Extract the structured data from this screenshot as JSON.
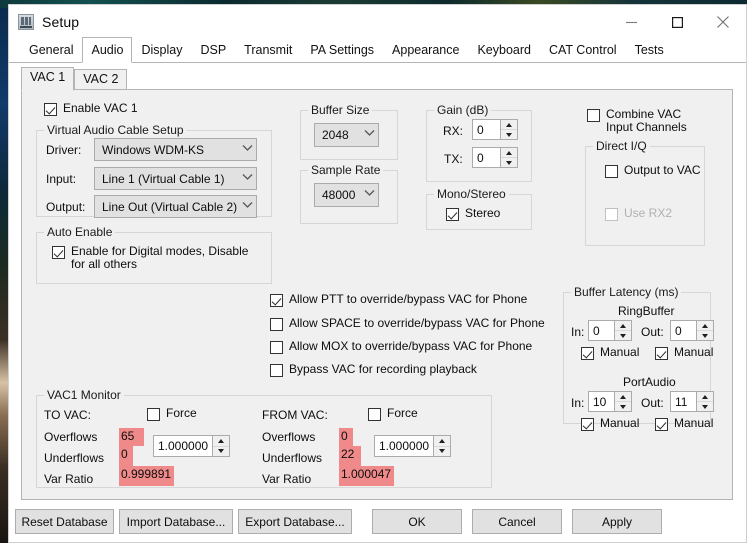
{
  "window": {
    "title": "Setup",
    "icon": "app-window-icon",
    "controls": {
      "minimize": "minimize-icon",
      "maximize": "maximize-icon",
      "close": "close-icon"
    }
  },
  "tabs": {
    "selected": "Audio",
    "items": [
      {
        "label": "General"
      },
      {
        "label": "Audio"
      },
      {
        "label": "Display"
      },
      {
        "label": "DSP"
      },
      {
        "label": "Transmit"
      },
      {
        "label": "PA Settings"
      },
      {
        "label": "Appearance"
      },
      {
        "label": "Keyboard"
      },
      {
        "label": "CAT Control"
      },
      {
        "label": "Tests"
      }
    ]
  },
  "subtabs": {
    "selected": "VAC 1",
    "items": [
      {
        "label": "VAC 1"
      },
      {
        "label": "VAC 2"
      }
    ]
  },
  "enable_vac": {
    "label": "Enable VAC 1",
    "checked": true
  },
  "vac_setup": {
    "title": "Virtual Audio Cable Setup",
    "driver": {
      "label": "Driver:",
      "value": "Windows WDM-KS"
    },
    "input": {
      "label": "Input:",
      "value": "Line 1 (Virtual Cable 1)"
    },
    "output": {
      "label": "Output:",
      "value": "Line Out (Virtual Cable 2)"
    }
  },
  "auto_enable": {
    "title": "Auto Enable",
    "checkbox": {
      "label": "Enable for Digital modes, Disable\nfor all others",
      "checked": true
    }
  },
  "buffer_size": {
    "title": "Buffer Size",
    "value": "2048"
  },
  "sample_rate": {
    "title": "Sample Rate",
    "value": "48000"
  },
  "gain": {
    "title": "Gain (dB)",
    "rx": {
      "label": "RX:",
      "value": "0"
    },
    "tx": {
      "label": "TX:",
      "value": "0"
    }
  },
  "mono_stereo": {
    "title": "Mono/Stereo",
    "stereo": {
      "label": "Stereo",
      "checked": true
    }
  },
  "combine_vac": {
    "label": "Combine VAC\nInput Channels",
    "checked": false
  },
  "direct_iq": {
    "title": "Direct I/Q",
    "output_to_vac": {
      "label": "Output to VAC",
      "checked": false,
      "disabled": false
    },
    "use_rx2": {
      "label": "Use RX2",
      "checked": false,
      "disabled": true
    }
  },
  "overrides": [
    {
      "label": "Allow PTT to override/bypass VAC for Phone",
      "checked": true
    },
    {
      "label": "Allow SPACE to override/bypass VAC for Phone",
      "checked": false
    },
    {
      "label": "Allow MOX to override/bypass VAC for Phone",
      "checked": false
    },
    {
      "label": "Bypass VAC for recording playback",
      "checked": false
    }
  ],
  "buffer_latency": {
    "title": "Buffer Latency (ms)",
    "ringbuffer": {
      "heading": "RingBuffer",
      "in": {
        "label": "In:",
        "value": "0"
      },
      "out": {
        "label": "Out:",
        "value": "0"
      },
      "in_manual": {
        "label": "Manual",
        "checked": true
      },
      "out_manual": {
        "label": "Manual",
        "checked": true
      }
    },
    "portaudio": {
      "heading": "PortAudio",
      "in": {
        "label": "In:",
        "value": "10"
      },
      "out": {
        "label": "Out:",
        "value": "11"
      },
      "in_manual": {
        "label": "Manual",
        "checked": true
      },
      "out_manual": {
        "label": "Manual",
        "checked": true
      }
    }
  },
  "monitor": {
    "title": "VAC1 Monitor",
    "to_vac": {
      "heading": "TO VAC:",
      "force": {
        "label": "Force",
        "checked": false
      },
      "ratio_value": "1.000000",
      "rows": [
        {
          "label": "Overflows",
          "value": "65",
          "highlight": true
        },
        {
          "label": "Underflows",
          "value": "0",
          "highlight": true
        },
        {
          "label": "Var Ratio",
          "value": "0.999891",
          "highlight": true
        }
      ]
    },
    "from_vac": {
      "heading": "FROM VAC:",
      "force": {
        "label": "Force",
        "checked": false
      },
      "ratio_value": "1.000000",
      "rows": [
        {
          "label": "Overflows",
          "value": "0",
          "highlight": true
        },
        {
          "label": "Underflows",
          "value": "22",
          "highlight": true
        },
        {
          "label": "Var Ratio",
          "value": "1.000047",
          "highlight": true
        }
      ]
    }
  },
  "footer": {
    "reset": "Reset Database",
    "import": "Import Database...",
    "export": "Export Database...",
    "ok": "OK",
    "cancel": "Cancel",
    "apply": "Apply"
  },
  "colors": {
    "highlight": "#f08a8a",
    "panel": "#f0f0f0",
    "border": "#b4b4b4"
  }
}
